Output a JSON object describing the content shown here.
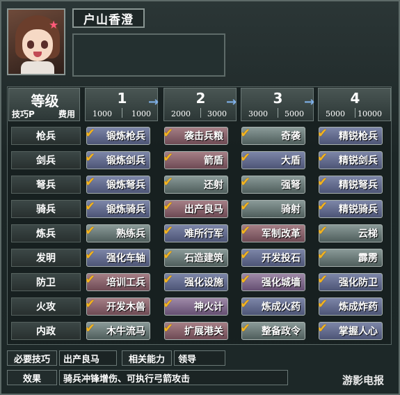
{
  "character": {
    "name": "户山香澄"
  },
  "header": {
    "level_label": "等级",
    "tech_points_label": "技巧P",
    "cost_label": "费用",
    "levels": [
      {
        "level": "1",
        "tech_points": "1000",
        "cost": "1000"
      },
      {
        "level": "2",
        "tech_points": "2000",
        "cost": "3000"
      },
      {
        "level": "3",
        "tech_points": "3000",
        "cost": "5000"
      },
      {
        "level": "4",
        "tech_points": "5000",
        "cost": "10000"
      }
    ]
  },
  "rows": [
    {
      "category": "枪兵",
      "skills": [
        "锻炼枪兵",
        "袭击兵粮",
        "奇袭",
        "精锐枪兵"
      ]
    },
    {
      "category": "剑兵",
      "skills": [
        "锻炼剑兵",
        "箭盾",
        "大盾",
        "精锐剑兵"
      ]
    },
    {
      "category": "弩兵",
      "skills": [
        "锻炼弩兵",
        "还射",
        "强弩",
        "精锐弩兵"
      ]
    },
    {
      "category": "骑兵",
      "skills": [
        "锻炼骑兵",
        "出产良马",
        "骑射",
        "精锐骑兵"
      ]
    },
    {
      "category": "炼兵",
      "skills": [
        "熟练兵",
        "难所行军",
        "军制改革",
        "云梯"
      ]
    },
    {
      "category": "发明",
      "skills": [
        "强化车轴",
        "石造建筑",
        "开发投石",
        "霹雳"
      ]
    },
    {
      "category": "防卫",
      "skills": [
        "培训工兵",
        "强化设施",
        "强化城墙",
        "强化防卫"
      ]
    },
    {
      "category": "火攻",
      "skills": [
        "开发木兽",
        "神火计",
        "炼成火药",
        "炼成炸药"
      ]
    },
    {
      "category": "内政",
      "skills": [
        "木牛流马",
        "扩展港关",
        "整备政令",
        "掌握人心"
      ]
    }
  ],
  "footer": {
    "required_skill_label": "必要技巧",
    "required_skill_value": "出产良马",
    "related_ability_label": "相关能力",
    "related_ability_value": "领导",
    "effect_label": "效果",
    "effect_value": "骑兵冲锋增伤、可执行弓箭攻击"
  },
  "watermark": "游影电报",
  "colors": {
    "check": "#f2b320",
    "arrow": "#7fb0e8"
  },
  "icons": {
    "check": "check-icon",
    "arrow": "arrow-right-icon"
  }
}
